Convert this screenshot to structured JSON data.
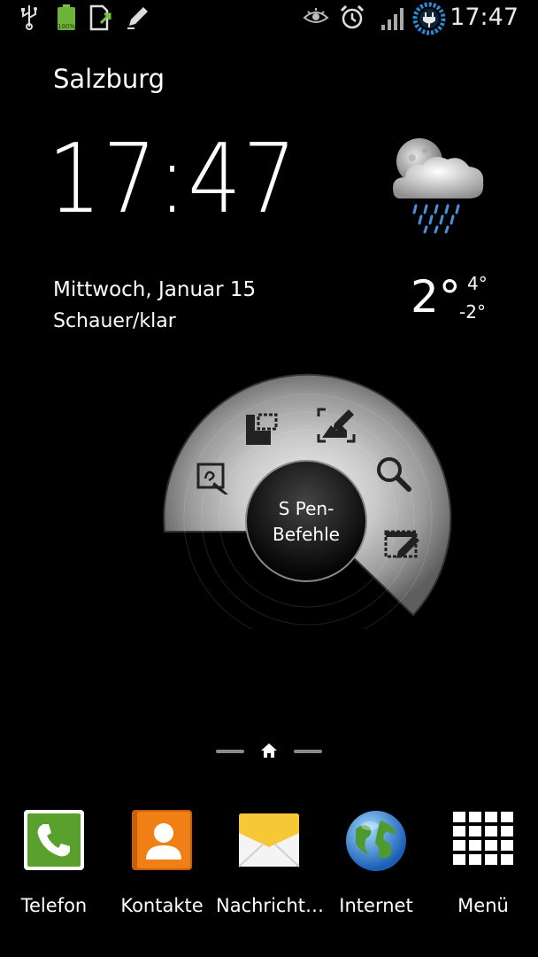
{
  "status_bar": {
    "time": "17:47",
    "battery_text": "100%",
    "icons": [
      "usb-icon",
      "battery-icon",
      "file-transfer-icon",
      "pen-icon",
      "eye-icon",
      "alarm-icon",
      "signal-icon",
      "power-saving-icon"
    ]
  },
  "weather": {
    "city": "Salzburg",
    "time": "17:47",
    "date": "Mittwoch, Januar 15",
    "condition": "Schauer/klar",
    "temperature": "2°",
    "high": "4°",
    "low": "-2°",
    "icon": "moon-cloud-rain-icon"
  },
  "spen_menu": {
    "center_label": "S Pen-Befehle",
    "actions": [
      "action-memo-icon",
      "scrapbook-icon",
      "screen-write-icon",
      "s-finder-icon",
      "pen-window-icon"
    ]
  },
  "pager": {
    "home_icon": "home-icon"
  },
  "dock": [
    {
      "label": "Telefon",
      "icon": "phone-icon",
      "color": "#5aa02c"
    },
    {
      "label": "Kontakte",
      "icon": "contacts-icon",
      "color": "#f07f16"
    },
    {
      "label": "Nachricht…",
      "icon": "messages-icon",
      "color": "#f7c836"
    },
    {
      "label": "Internet",
      "icon": "globe-icon",
      "color": "#2f7fd3"
    },
    {
      "label": "Menü",
      "icon": "apps-grid-icon",
      "color": "#ffffff"
    }
  ]
}
